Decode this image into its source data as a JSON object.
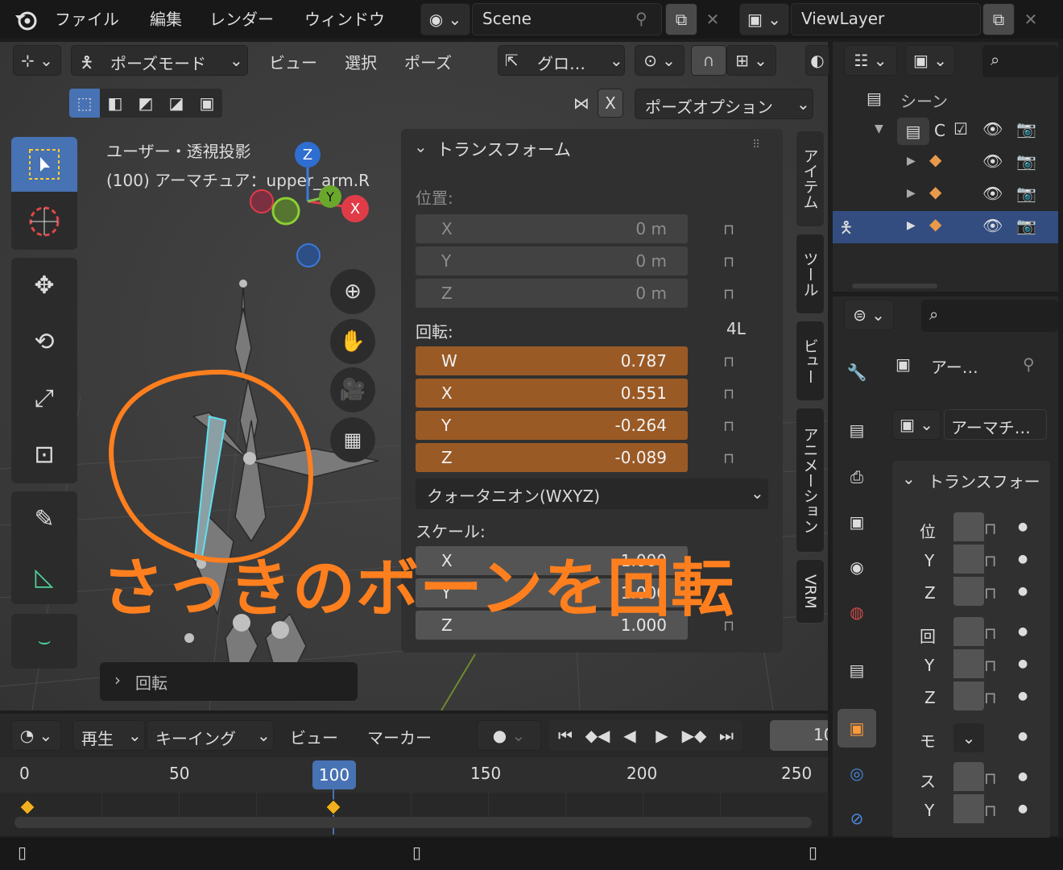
{
  "top_menu": {
    "items": [
      "ファイル",
      "編集",
      "レンダー",
      "ウィンドウ"
    ],
    "scene_name": "Scene",
    "view_layer": "ViewLayer"
  },
  "viewport_header": {
    "mode": "ポーズモード",
    "menus": [
      "ビュー",
      "選択",
      "ポーズ"
    ],
    "orientation": "グロ…",
    "x_mirror": "X",
    "pose_options": "ポーズオプション"
  },
  "overlay_info": {
    "view_name": "ユーザー・透視投影",
    "object_info": "(100) アーマチュア：upper_arm.R"
  },
  "gizmo": {
    "z": "Z",
    "y": "Y",
    "x": "X"
  },
  "transform_panel": {
    "title": "トランスフォーム",
    "location_label": "位置:",
    "location": [
      {
        "axis": "X",
        "value": "0 m"
      },
      {
        "axis": "Y",
        "value": "0 m"
      },
      {
        "axis": "Z",
        "value": "0 m"
      }
    ],
    "rotation_label": "回転:",
    "rotation_lock_label": "4L",
    "rotation": [
      {
        "axis": "W",
        "value": "0.787"
      },
      {
        "axis": "X",
        "value": "0.551"
      },
      {
        "axis": "Y",
        "value": "-0.264"
      },
      {
        "axis": "Z",
        "value": "-0.089"
      }
    ],
    "rotation_mode": "クォータニオン(WXYZ)",
    "scale_label": "スケール:",
    "scale": [
      {
        "axis": "X",
        "value": "1.000"
      },
      {
        "axis": "Y",
        "value": "1.000"
      },
      {
        "axis": "Z",
        "value": "1.000"
      }
    ]
  },
  "sidebar_tabs": [
    "アイテム",
    "ツール",
    "ビュー",
    "アニメーション",
    "VRM"
  ],
  "last_operator": "回転",
  "annotation_text": "さっきのボーンを回転",
  "outliner": {
    "scene_label": "シーン",
    "collection_label": "C"
  },
  "properties": {
    "object_name": "アー…",
    "data_name": "アーマチ…",
    "section_title": "トランスフォー",
    "rows": [
      "位",
      "Y",
      "Z",
      "回",
      "Y",
      "Z",
      "モ",
      "ス",
      "Y"
    ]
  },
  "timeline": {
    "menus": [
      "再生",
      "キーイング",
      "ビュー",
      "マーカー"
    ],
    "frame_field": "10",
    "ruler_labels": [
      "0",
      "50",
      "100",
      "150",
      "200",
      "250"
    ],
    "current_frame": 100,
    "keyframes": [
      0,
      100
    ]
  },
  "colors": {
    "orange_field": "#9a5a25",
    "annotation": "#ff7f1e",
    "selection_blue": "#4772b3",
    "playhead": "#4772b3"
  }
}
